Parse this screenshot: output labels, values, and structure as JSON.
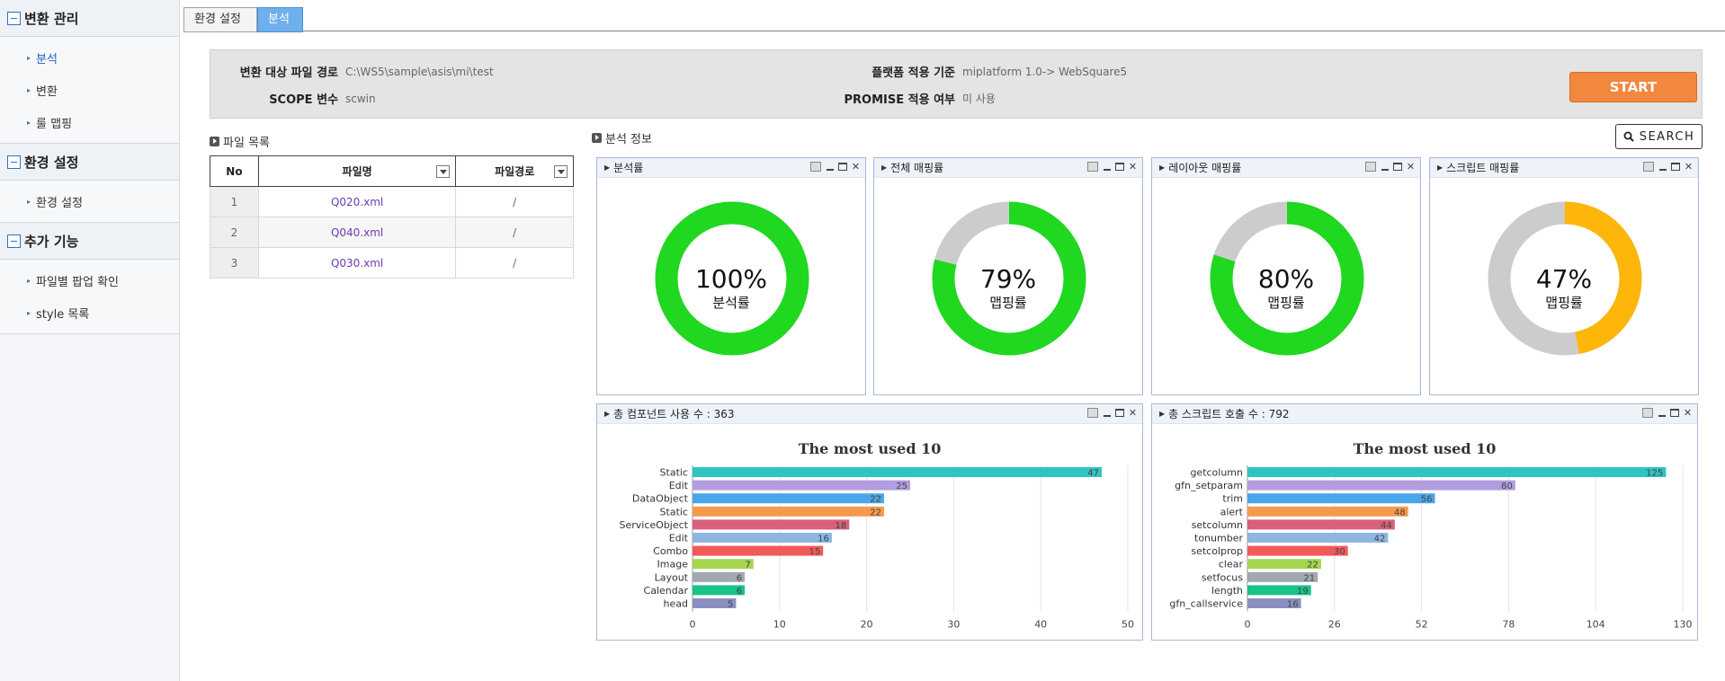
{
  "sidebar": {
    "sections": [
      {
        "title": "변환 관리",
        "items": [
          {
            "label": "분석",
            "active": true
          },
          {
            "label": "변환"
          },
          {
            "label": "룰 맵핑"
          }
        ]
      },
      {
        "title": "환경 설정",
        "items": [
          {
            "label": "환경 설정"
          }
        ]
      },
      {
        "title": "추가 기능",
        "items": [
          {
            "label": "파일별 팝업 확인"
          },
          {
            "label": "style 목록"
          }
        ]
      }
    ]
  },
  "tabs": [
    {
      "label": "환경 설정"
    },
    {
      "label": "분석",
      "active": true
    }
  ],
  "info": {
    "path_label": "변환 대상 파일 경로",
    "path_value": "C:\\WS5\\sample\\asis\\mi\\test",
    "scope_label": "SCOPE 변수",
    "scope_value": "scwin",
    "platform_label": "플랫폼 적용 기준",
    "platform_value": "miplatform 1.0-> WebSquare5",
    "promise_label": "PROMISE 적용 여부",
    "promise_value": "미 사용",
    "start_label": "START"
  },
  "filelist": {
    "title": "파일 목록",
    "headers": [
      "No",
      "파일명",
      "파일경로"
    ],
    "rows": [
      [
        "1",
        "Q020.xml",
        "/"
      ],
      [
        "2",
        "Q040.xml",
        "/"
      ],
      [
        "3",
        "Q030.xml",
        "/"
      ]
    ]
  },
  "analysis": {
    "title": "분석 정보",
    "search_label": "SEARCH"
  },
  "donuts": [
    {
      "title": "분석률",
      "percent": 100,
      "pct_text": "100%",
      "sub": "분석률",
      "color": "#1fd81f"
    },
    {
      "title": "전체 매핑률",
      "percent": 79,
      "pct_text": "79%",
      "sub": "맵핑률",
      "color": "#1fd81f"
    },
    {
      "title": "레이아웃 매핑률",
      "percent": 80,
      "pct_text": "80%",
      "sub": "맵핑률",
      "color": "#1fd81f"
    },
    {
      "title": "스크립트 매핑률",
      "percent": 47,
      "pct_text": "47%",
      "sub": "맵핑률",
      "color": "#ffb60a"
    }
  ],
  "chart_data": [
    {
      "type": "bar",
      "panel_title": "총 컴포넌트 사용 수 : 363",
      "title": "The most used 10",
      "categories": [
        "Static",
        "Edit",
        "DataObject",
        "Static",
        "ServiceObject",
        "Edit",
        "Combo",
        "Image",
        "Layout",
        "Calendar",
        "head"
      ],
      "values": [
        47,
        25,
        22,
        22,
        18,
        16,
        15,
        7,
        6,
        6,
        5
      ],
      "colors": [
        "#2ec4c4",
        "#b19de0",
        "#4aa6e8",
        "#f59a4c",
        "#d95f7a",
        "#8db7e0",
        "#f25a5a",
        "#a6d650",
        "#a2a8b2",
        "#19c28a",
        "#8a8fc2"
      ],
      "xlim": [
        0,
        50
      ],
      "xticks": [
        0,
        10,
        20,
        30,
        40,
        50
      ],
      "grid": true
    },
    {
      "type": "bar",
      "panel_title": "총 스크립트 호출 수 : 792",
      "title": "The most used 10",
      "categories": [
        "getcolumn",
        "gfn_setparam",
        "trim",
        "alert",
        "setcolumn",
        "tonumber",
        "setcolprop",
        "clear",
        "setfocus",
        "length",
        "gfn_callservice"
      ],
      "values": [
        125,
        80,
        56,
        48,
        44,
        42,
        30,
        22,
        21,
        19,
        16
      ],
      "colors": [
        "#2ec4c4",
        "#b19de0",
        "#4aa6e8",
        "#f59a4c",
        "#d95f7a",
        "#8db7e0",
        "#f25a5a",
        "#a6d650",
        "#a2a8b2",
        "#19c28a",
        "#8a8fc2"
      ],
      "xlim": [
        0,
        130
      ],
      "xticks": [
        0,
        26,
        52,
        78,
        104,
        130
      ],
      "grid": true
    }
  ]
}
